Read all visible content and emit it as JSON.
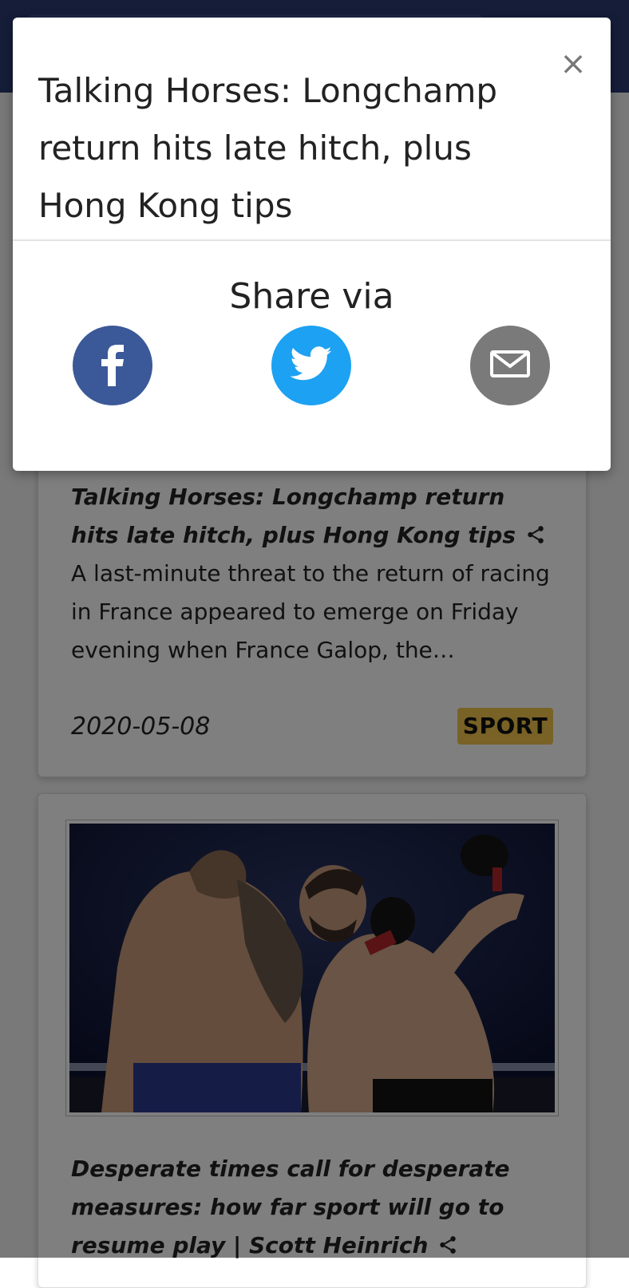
{
  "modal": {
    "title": "Talking Horses: Longchamp return hits late hitch, plus Hong Kong tips",
    "close_glyph": "×",
    "share_label": "Share via",
    "buttons": [
      {
        "name": "facebook",
        "icon": "facebook-icon",
        "color": "#3b5998"
      },
      {
        "name": "twitter",
        "icon": "twitter-icon",
        "color": "#1da1f2"
      },
      {
        "name": "email",
        "icon": "mail-icon",
        "color": "#7a7a7a"
      }
    ]
  },
  "articles": [
    {
      "title": "Talking Horses: Longchamp return hits late hitch, plus Hong Kong tips",
      "description": "A last-minute threat to the return of racing in France appeared to emerge on Friday evening when France Galop, the…",
      "date": "2020-05-08",
      "category": "SPORT"
    },
    {
      "title": "Desperate times call for desperate measures: how far sport will go to resume play | Scott Heinrich",
      "image_alt": "MMA fighters in a cage"
    }
  ],
  "colors": {
    "navbar": "#2b3a73",
    "badge": "#f0c54a",
    "backdrop": "rgba(0,0,0,0.5)"
  }
}
